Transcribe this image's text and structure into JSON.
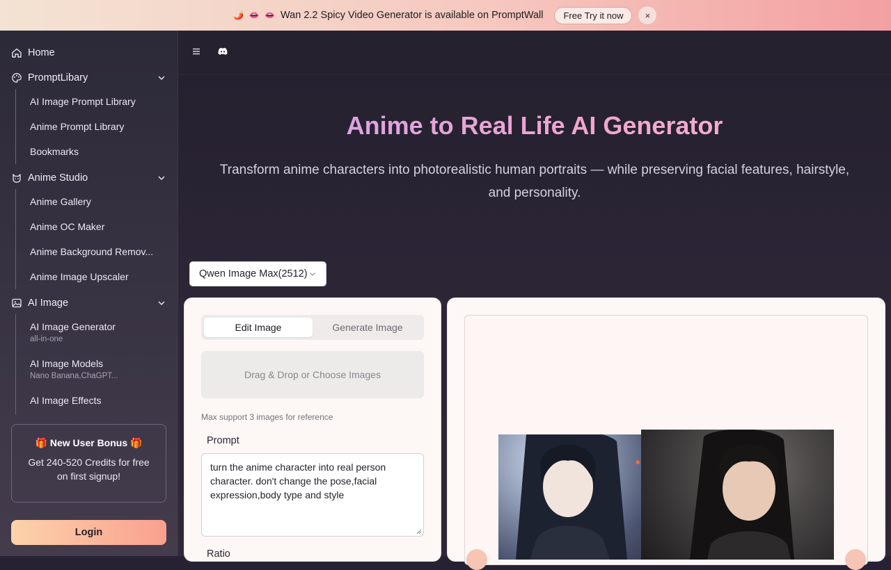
{
  "banner": {
    "emoji": "🌶️ 👄 👄",
    "message": "Wan 2.2 Spicy Video Generator is available on PromptWall",
    "try_label": "Free Try it now",
    "close_label": "×"
  },
  "sidebar": {
    "home": "Home",
    "prompt_library": {
      "label": "PromptLibary",
      "items": [
        "AI Image Prompt Library",
        "Anime Prompt Library",
        "Bookmarks"
      ]
    },
    "anime_studio": {
      "label": "Anime Studio",
      "items": [
        "Anime Gallery",
        "Anime OC Maker",
        "Anime Background Remov...",
        "Anime Image Upscaler"
      ]
    },
    "ai_image": {
      "label": "AI Image",
      "items": [
        {
          "label": "AI Image Generator",
          "sub": "all-in-one"
        },
        {
          "label": "AI Image Models",
          "sub": "Nano Banana,ChaGPT..."
        },
        {
          "label": "AI Image Effects",
          "sub": ""
        }
      ]
    },
    "bonus": {
      "gift": "🎁",
      "title": "New User Bonus",
      "desc": "Get 240-520 Credits for free on first signup!"
    },
    "login": "Login"
  },
  "hero": {
    "title": "Anime to Real Life AI Generator",
    "subtitle": "Transform anime characters into photorealistic human portraits — while preserving facial features, hairstyle, and personality."
  },
  "model_select": {
    "value": "Qwen Image Max(2512)"
  },
  "editor": {
    "tabs": [
      "Edit Image",
      "Generate Image"
    ],
    "dropzone": "Drag & Drop or Choose Images",
    "hint": "Max support 3 images for reference",
    "prompt_label": "Prompt",
    "prompt_value": "turn the anime character into real person character. don't change the pose,facial expression,body type and style",
    "ratio_label": "Ratio"
  },
  "colors": {
    "accent_gradient_start": "#fdd2aa",
    "accent_gradient_end": "#f9a08f",
    "title_gradient_start": "#cfa2f0",
    "title_gradient_end": "#f7b7c8"
  }
}
